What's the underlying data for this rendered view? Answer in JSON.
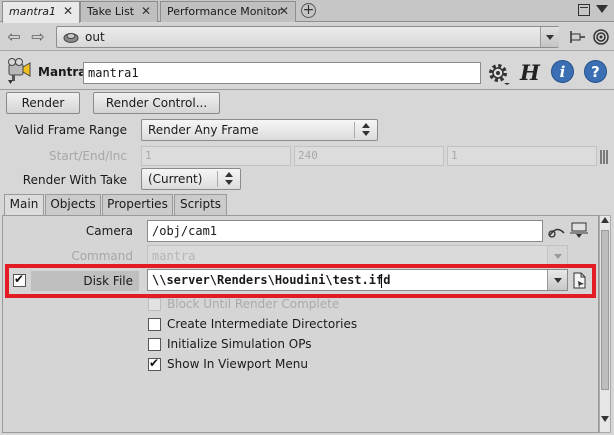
{
  "tabs": [
    {
      "label": "mantra1"
    },
    {
      "label": "Take List"
    },
    {
      "label": "Performance Monitor"
    }
  ],
  "path": {
    "value": "out"
  },
  "node": {
    "type_label": "Mantra",
    "name": "mantra1",
    "houdini_glyph": "H",
    "info_glyph": "i",
    "help_glyph": "?"
  },
  "buttons": {
    "render": "Render",
    "render_control": "Render Control..."
  },
  "params": {
    "valid_frame_range": {
      "label": "Valid Frame Range",
      "value": "Render Any Frame"
    },
    "start_end_inc": {
      "label": "Start/End/Inc",
      "values": [
        "1",
        "240",
        "1"
      ]
    },
    "render_with_take": {
      "label": "Render With Take",
      "value": "(Current)"
    }
  },
  "param_tabs": [
    "Main",
    "Objects",
    "Properties",
    "Scripts"
  ],
  "main": {
    "camera": {
      "label": "Camera",
      "value": "/obj/cam1"
    },
    "command": {
      "label": "Command",
      "value": "mantra"
    },
    "disk_file": {
      "label": "Disk File",
      "value": "\\\\server\\Renders\\Houdini\\test.ifd",
      "enabled": true
    },
    "checkboxes": [
      {
        "label": "Block Until Render Complete",
        "checked": false,
        "disabled": true
      },
      {
        "label": "Create Intermediate Directories",
        "checked": false,
        "disabled": false
      },
      {
        "label": "Initialize Simulation OPs",
        "checked": false,
        "disabled": false
      },
      {
        "label": "Show In Viewport Menu",
        "checked": true,
        "disabled": false
      }
    ]
  },
  "colors": {
    "highlight": "#e31b23",
    "info_blue": "#3b6fb4"
  }
}
